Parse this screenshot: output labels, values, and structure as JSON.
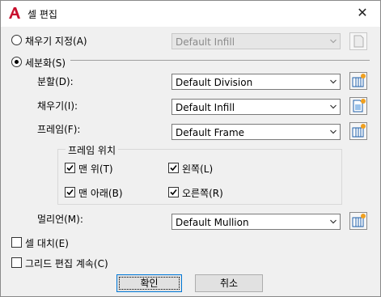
{
  "window": {
    "title": "셀 편집",
    "close_glyph": "✕",
    "app_icon": "autocad-a-icon",
    "accent": "#c8102e"
  },
  "fill_section": {
    "radio_label": "채우기 지정(A)",
    "selected": false,
    "select_value": "Default Infill",
    "enabled": false
  },
  "division_section": {
    "radio_label": "세분화(S)",
    "selected": true,
    "rows": [
      {
        "label": "분할(D):",
        "value": "Default Division"
      },
      {
        "label": "채우기(I):",
        "value": "Default Infill"
      },
      {
        "label": "프레임(F):",
        "value": "Default Frame"
      }
    ],
    "frame_position": {
      "title": "프레임 위치",
      "options": [
        {
          "label": "맨 위(T)",
          "checked": true
        },
        {
          "label": "왼쪽(L)",
          "checked": true
        },
        {
          "label": "맨 아래(B)",
          "checked": true
        },
        {
          "label": "오른쪽(R)",
          "checked": true
        }
      ]
    },
    "mullion": {
      "label": "멀리언(M):",
      "value": "Default Mullion"
    }
  },
  "bottom_checks": [
    {
      "label": "셀 대치(E)",
      "checked": false
    },
    {
      "label": "그리드 편집 계속(C)",
      "checked": false
    }
  ],
  "buttons": {
    "ok": "확인",
    "cancel": "취소"
  }
}
